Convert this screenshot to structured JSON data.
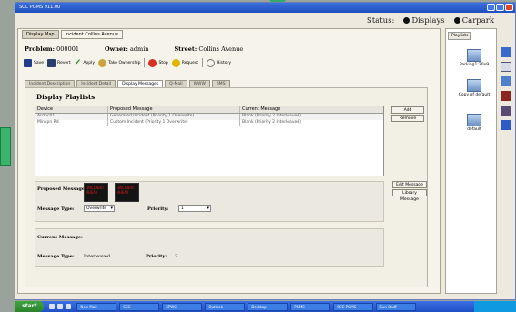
{
  "window": {
    "title": "SCC PGMS 911.00"
  },
  "status": {
    "label": "Status:",
    "displays": "Displays",
    "carpark": "Carpark"
  },
  "doctabs": [
    {
      "label": "Display Map"
    },
    {
      "label": "Incident Collins Avenue"
    }
  ],
  "incident": {
    "problem_label": "Problem:",
    "problem_value": "000001",
    "owner_label": "Owner:",
    "owner_value": "admin",
    "street_label": "Street:",
    "street_value": "Collins Avenue"
  },
  "toolbar": {
    "save": "Save",
    "revert": "Revert",
    "apply": "Apply",
    "ownership": "Take Ownership",
    "stop": "Stop",
    "request": "Request",
    "history": "History"
  },
  "subtabs": [
    {
      "label": "Incident Description"
    },
    {
      "label": "Incident Detail"
    },
    {
      "label": "Display Messages"
    },
    {
      "label": "Q-Mail"
    },
    {
      "label": "WWW"
    },
    {
      "label": "SMS"
    }
  ],
  "playlists": {
    "title": "Display Playlists",
    "columns": [
      "Device",
      "Proposed Message",
      "Current Message"
    ],
    "rows": [
      {
        "device": "Anzac01",
        "proposed": "Generated Incident (Priority 1 Overwrite)",
        "current": "Blank (Priority 2 Interleaved)"
      },
      {
        "device": "Mincpn Rd",
        "proposed": "Custom Incident (Priority 1 Overwrite)",
        "current": "Blank (Priority 2 Interleaved)"
      }
    ],
    "add_button": "Add",
    "remove_button": "Remove"
  },
  "proposed": {
    "label": "Proposed Message:",
    "type_label": "Message Type:",
    "type_value": "Overwrite",
    "priority_label": "Priority:",
    "priority_value": "1",
    "edit_button": "Edit Message",
    "library_button": "Library Message",
    "led1": "INCIDENT AHEAD",
    "led2": "INCIDENT AHEAD"
  },
  "current": {
    "label": "Current Message:",
    "type_label": "Message Type:",
    "type_value": "Interleaved",
    "priority_label": "Priority:",
    "priority_value": "3"
  },
  "right_panel": {
    "tab": "Playlists",
    "items": [
      {
        "label": "Parking1:20x9"
      },
      {
        "label": "Copy of default"
      },
      {
        "label": "default"
      }
    ]
  },
  "taskbar": {
    "start": "start",
    "tasks": [
      "New Mail",
      "SCC",
      "SPWC",
      "Outlook",
      "Desktop",
      "PGMS",
      "SCC PGMS",
      "Sun Stuff"
    ]
  },
  "colors": {
    "accent": "#1f4fc0",
    "start_green": "#2b832c",
    "led_red": "#d01a1a"
  }
}
